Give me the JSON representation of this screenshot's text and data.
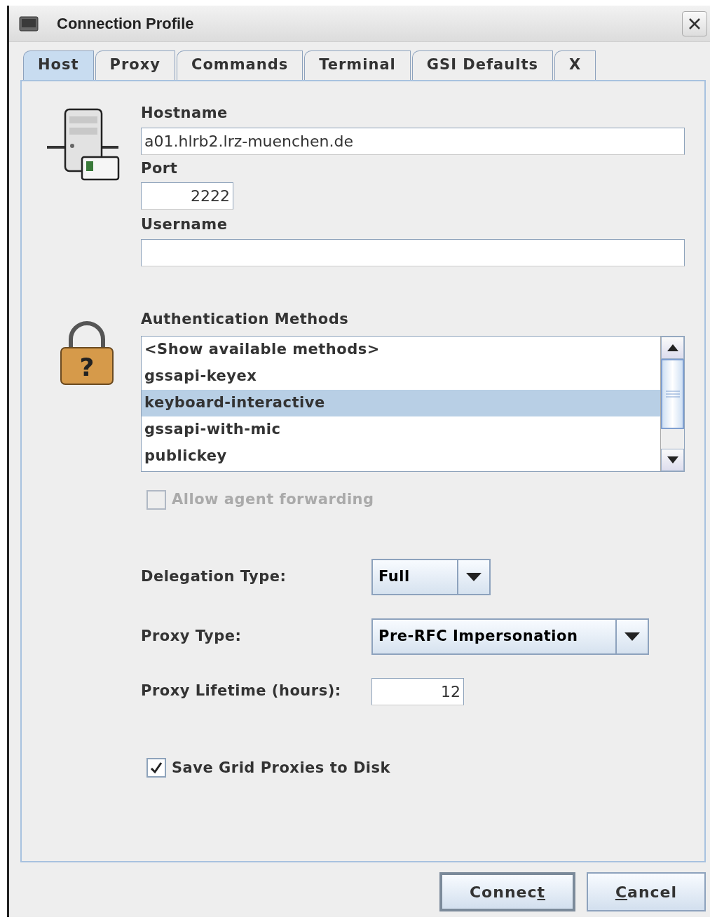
{
  "window": {
    "title": "Connection Profile"
  },
  "tabs": [
    {
      "label": "Host",
      "selected": true
    },
    {
      "label": "Proxy",
      "selected": false
    },
    {
      "label": "Commands",
      "selected": false
    },
    {
      "label": "Terminal",
      "selected": false
    },
    {
      "label": "GSI Defaults",
      "selected": false
    },
    {
      "label": "X",
      "selected": false
    }
  ],
  "host": {
    "hostname_label": "Hostname",
    "hostname": "a01.hlrb2.lrz-muenchen.de",
    "port_label": "Port",
    "port": "2222",
    "username_label": "Username"
  },
  "auth": {
    "icon_glyph": "?",
    "label": "Authentication Methods",
    "methods": [
      {
        "name": "<Show available methods>",
        "selected": false
      },
      {
        "name": "gssapi-keyex",
        "selected": false
      },
      {
        "name": "keyboard-interactive",
        "selected": true
      },
      {
        "name": "gssapi-with-mic",
        "selected": false
      },
      {
        "name": "publickey",
        "selected": false
      }
    ],
    "agent_forwarding": {
      "label": "Allow agent forwarding",
      "checked": false,
      "disabled": true
    }
  },
  "gsi": {
    "delegation_label": "Delegation Type:",
    "delegation": "Full",
    "proxy_type_label": "Proxy Type:",
    "proxy_type": "Pre-RFC Impersonation",
    "lifetime_label": "Proxy Lifetime (hours):",
    "lifetime": "12",
    "save_proxies": {
      "label": "Save Grid Proxies to Disk",
      "checked": true,
      "disabled": false
    }
  },
  "buttons": [
    {
      "label_before": "Connec",
      "mnemonic": "t",
      "default": true
    },
    {
      "mnemonic": "C",
      "label_after": "ancel",
      "default": false
    }
  ]
}
